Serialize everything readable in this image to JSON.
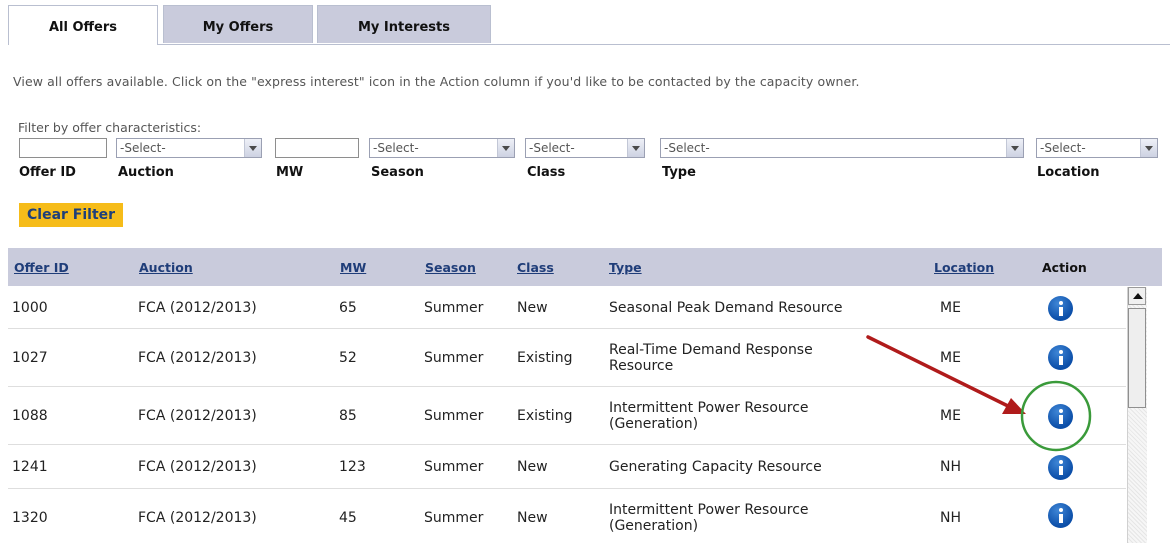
{
  "tabs": [
    {
      "label": "All Offers",
      "active": true
    },
    {
      "label": "My Offers",
      "active": false
    },
    {
      "label": "My Interests",
      "active": false
    }
  ],
  "description": "View all offers available. Click on the \"express interest\" icon in the Action column if you'd like to be contacted by the capacity owner.",
  "filter": {
    "caption": "Filter by offer characteristics:",
    "offer_id_value": "",
    "auction_select": "-Select-",
    "mw_value": "",
    "season_select": "-Select-",
    "class_select": "-Select-",
    "type_select": "-Select-",
    "location_select": "-Select-",
    "labels": {
      "offer_id": "Offer ID",
      "auction": "Auction",
      "mw": "MW",
      "season": "Season",
      "class": "Class",
      "type": "Type",
      "location": "Location"
    },
    "clear_button": "Clear Filter"
  },
  "table": {
    "headers": {
      "offer_id": "Offer ID",
      "auction": "Auction",
      "mw": "MW",
      "season": "Season",
      "class": "Class",
      "type": "Type",
      "location": "Location",
      "action": "Action"
    },
    "rows": [
      {
        "offer_id": "1000",
        "auction": "FCA (2012/2013)",
        "mw": "65",
        "season": "Summer",
        "class": "New",
        "type": "Seasonal Peak Demand Resource",
        "location": "ME",
        "action_icon": "info-icon"
      },
      {
        "offer_id": "1027",
        "auction": "FCA (2012/2013)",
        "mw": "52",
        "season": "Summer",
        "class": "Existing",
        "type": "Real-Time Demand Response Resource",
        "location": "ME",
        "action_icon": "info-icon"
      },
      {
        "offer_id": "1088",
        "auction": "FCA (2012/2013)",
        "mw": "85",
        "season": "Summer",
        "class": "Existing",
        "type": "Intermittent Power Resource (Generation)",
        "location": "ME",
        "action_icon": "info-icon"
      },
      {
        "offer_id": "1241",
        "auction": "FCA (2012/2013)",
        "mw": "123",
        "season": "Summer",
        "class": "New",
        "type": "Generating Capacity Resource",
        "location": "NH",
        "action_icon": "info-icon"
      },
      {
        "offer_id": "1320",
        "auction": "FCA (2012/2013)",
        "mw": "45",
        "season": "Summer",
        "class": "New",
        "type": "Intermittent Power Resource (Generation)",
        "location": "NH",
        "action_icon": "info-icon"
      }
    ]
  },
  "colors": {
    "header_bg": "#c9cbdc",
    "link": "#1f3d79",
    "button_bg": "#f6bc19",
    "info_icon": "#0b4ea8",
    "annotation_arrow": "#b01b1b",
    "annotation_circle": "#3a9a3a"
  }
}
